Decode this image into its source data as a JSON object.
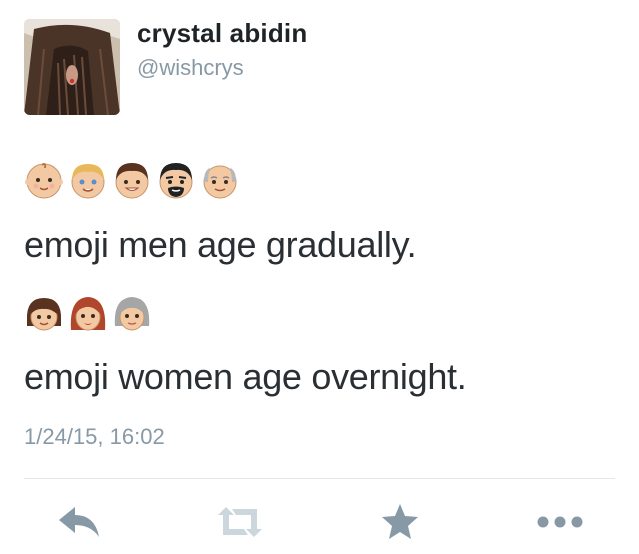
{
  "user": {
    "display_name": "crystal abidin",
    "handle": "@wishcrys"
  },
  "tweet": {
    "men_emojis": [
      "baby-face",
      "boy-face",
      "man-face",
      "bearded-man-face",
      "older-man-face"
    ],
    "line1": "emoji men age gradually.",
    "women_emojis": [
      "girl-face",
      "woman-face",
      "older-woman-face"
    ],
    "line2": "emoji women age overnight.",
    "timestamp": "1/24/15, 16:02"
  },
  "actions": {
    "reply_icon": "reply-icon",
    "retweet_icon": "retweet-icon",
    "favorite_icon": "star-icon",
    "more_icon": "more-icon"
  },
  "colors": {
    "secondary_text": "#8899a6",
    "action_icon": "#8899a6",
    "divider": "#e1e8ed"
  }
}
